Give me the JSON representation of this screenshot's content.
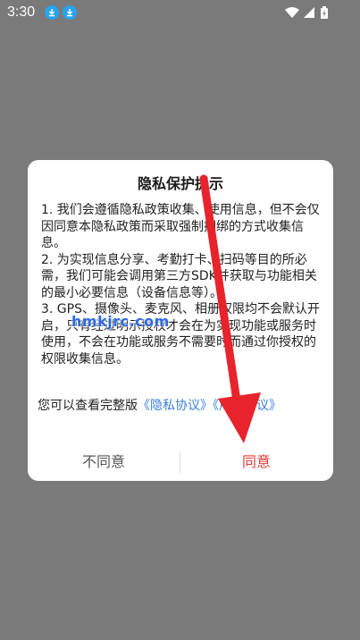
{
  "status_bar": {
    "time": "3:30",
    "icons": [
      "download-icon",
      "download-icon",
      "wifi-icon",
      "cellular-icon",
      "battery-icon"
    ]
  },
  "dialog": {
    "title": "隐私保护提示",
    "paragraphs": [
      "1. 我们会遵循隐私政策收集、使用信息，但不会仅因同意本隐私政策而采取强制捆绑的方式收集信息。",
      "2. 为实现信息分享、考勤打卡、扫码等目的所必需，我们可能会调用第三方SDK并获取与功能相关的最小必要信息（设备信息等）。",
      "3. GPS、摄像头、麦克风、相册权限均不会默认开启，只有经过明示授权才会在为实现功能或服务时使用，不会在功能或服务不需要时而通过你授权的权限收集信息。"
    ],
    "links_prefix": "您可以查看完整版",
    "privacy_link": "《隐私协议》",
    "user_link": "《用户协议》",
    "disagree_label": "不同意",
    "agree_label": "同意"
  },
  "watermark": "hmkjrc.com",
  "colors": {
    "overlay": "#7a7a7a",
    "link": "#3b7fd9",
    "agree": "#e03a3a",
    "arrow": "#e8232b"
  }
}
